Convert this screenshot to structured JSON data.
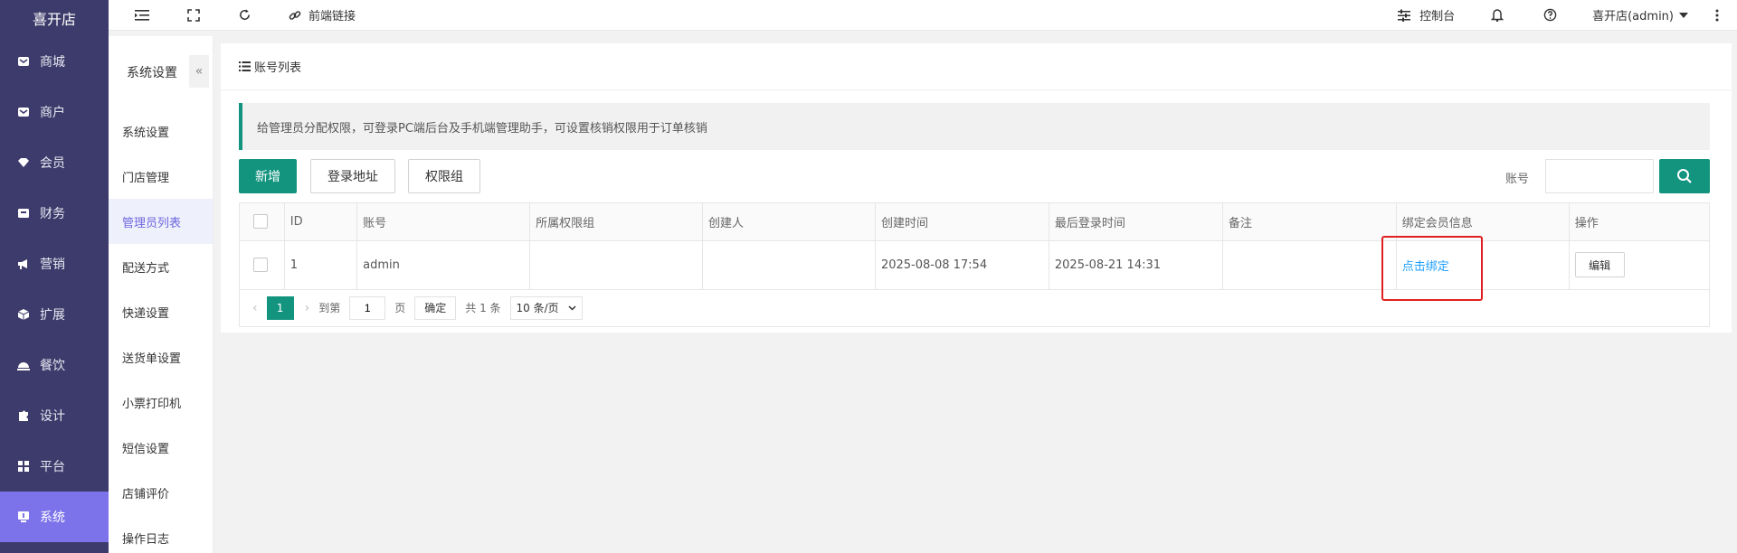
{
  "brand": "喜开店",
  "sidebar": {
    "items": [
      {
        "label": "商城",
        "icon": "shop-icon"
      },
      {
        "label": "商户",
        "icon": "store-icon"
      },
      {
        "label": "会员",
        "icon": "diamond-icon"
      },
      {
        "label": "财务",
        "icon": "wallet-icon"
      },
      {
        "label": "营销",
        "icon": "megaphone-icon"
      },
      {
        "label": "扩展",
        "icon": "cube-icon"
      },
      {
        "label": "餐饮",
        "icon": "dish-icon"
      },
      {
        "label": "设计",
        "icon": "puzzle-icon"
      },
      {
        "label": "平台",
        "icon": "grid-icon"
      },
      {
        "label": "系统",
        "icon": "monitor-icon"
      }
    ],
    "active_label": "系统"
  },
  "subnav": {
    "title": "系统设置",
    "collapse_icon": "«",
    "items": [
      "系统设置",
      "门店管理",
      "管理员列表",
      "配送方式",
      "快递设置",
      "送货单设置",
      "小票打印机",
      "短信设置",
      "店铺评价",
      "操作日志"
    ],
    "active": "管理员列表"
  },
  "topbar": {
    "frontend_link": "前端链接",
    "console": "控制台",
    "user": "喜开店(admin)"
  },
  "panel": {
    "title": "账号列表",
    "tip": "给管理员分配权限，可登录PC端后台及手机端管理助手，可设置核销权限用于订单核销",
    "buttons": {
      "add": "新增",
      "login_url": "登录地址",
      "perm_group": "权限组"
    },
    "search": {
      "label": "账号",
      "value": ""
    }
  },
  "table": {
    "headers": [
      "ID",
      "账号",
      "所属权限组",
      "创建人",
      "创建时间",
      "最后登录时间",
      "备注",
      "绑定会员信息",
      "操作"
    ],
    "rows": [
      {
        "id": "1",
        "account": "admin",
        "group": "",
        "creator": "",
        "created": "2025-08-08 17:54",
        "last_login": "2025-08-21 14:31",
        "note": "",
        "bind": "点击绑定",
        "action": "编辑"
      }
    ]
  },
  "pagination": {
    "current": "1",
    "goto_label": "到第",
    "goto_value": "1",
    "page_label": "页",
    "confirm": "确定",
    "total": "共 1 条",
    "per_page": "10 条/页"
  },
  "colors": {
    "sidebar_bg": "#3d3b6b",
    "sidebar_active": "#7c73ea",
    "primary": "#13947f",
    "link": "#1e9fff",
    "highlight": "#e02020"
  }
}
